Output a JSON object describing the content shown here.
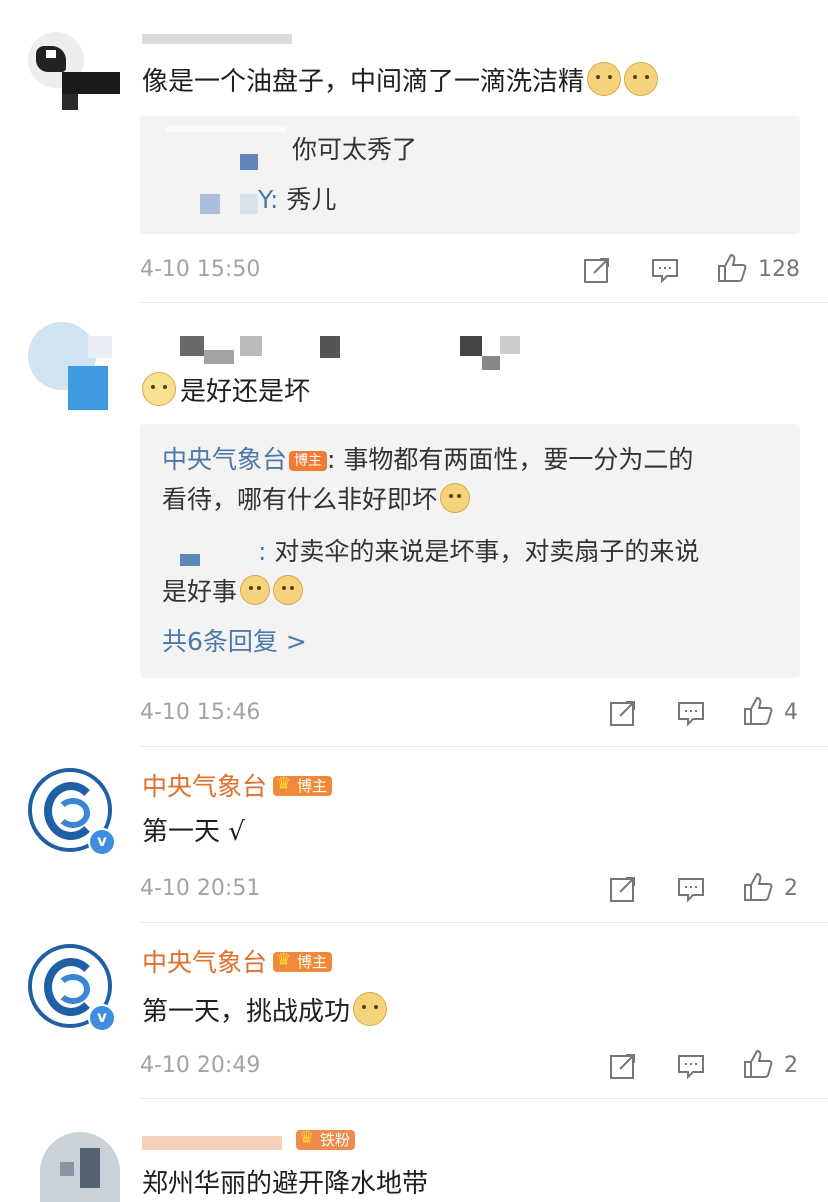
{
  "colors": {
    "name": "#e0702a",
    "link": "#4d79a8",
    "time": "#a3a3a3",
    "reply_bg": "#f3f3f3"
  },
  "comments": [
    {
      "user": "",
      "text": "像是一个油盘子，中间滴了一滴洗洁精",
      "replies": [
        {
          "user": "",
          "text": "你可太秀了"
        },
        {
          "user": "Y:",
          "text": " 秀儿"
        }
      ],
      "time": "4-10 15:50",
      "likes": "128"
    },
    {
      "user": "",
      "text": "是好还是坏",
      "replies": [
        {
          "user": "中央气象台",
          "badge": "博主",
          "text": ": 事物都有两面性，要一分为二的",
          "text2": "看待，哪有什么非好即坏"
        },
        {
          "user": ":",
          "text": " 对卖伞的来说是坏事，对卖扇子的来说",
          "text2": "是好事"
        }
      ],
      "more_replies": "共6条回复 >",
      "time": "4-10 15:46",
      "likes": "4"
    },
    {
      "user": "中央气象台",
      "badge": "博主",
      "text": "第一天 √",
      "time": "4-10 20:51",
      "likes": "2"
    },
    {
      "user": "中央气象台",
      "badge": "博主",
      "text": "第一天，挑战成功",
      "time": "4-10 20:49",
      "likes": "2"
    },
    {
      "user": "",
      "badge": "铁粉",
      "text": "郑州华丽的避开降水地带"
    }
  ],
  "icons": {
    "share": "share-icon",
    "comment": "comment-icon",
    "like": "like-icon",
    "verified": "verified-icon",
    "emoji": "doge-emoji-icon",
    "emoji_glasses": "glasses-emoji-icon"
  }
}
